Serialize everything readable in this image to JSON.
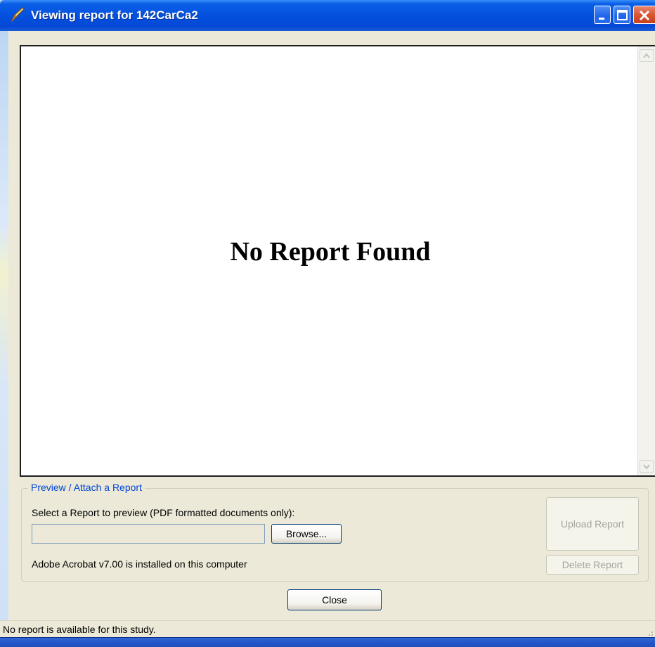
{
  "window": {
    "title": "Viewing report for 142CarCa2",
    "icon": "pen-icon",
    "controls": [
      "minimize-icon",
      "maximize-icon",
      "close-icon"
    ]
  },
  "viewer": {
    "message": "No Report Found"
  },
  "attach_group": {
    "legend": "Preview / Attach a Report",
    "instruction": "Select a Report to preview (PDF formatted documents only):",
    "file_path_value": "",
    "browse_label": "Browse...",
    "acrobat_status": "Adobe Acrobat v7.00 is installed on this computer",
    "upload_label": "Upload Report",
    "delete_label": "Delete Report"
  },
  "close_label": "Close",
  "status_text": "No report is available for this study.",
  "colors": {
    "titlebar": "#0451df",
    "legend_text": "#0046d5",
    "window_bg": "#ece9d8"
  }
}
